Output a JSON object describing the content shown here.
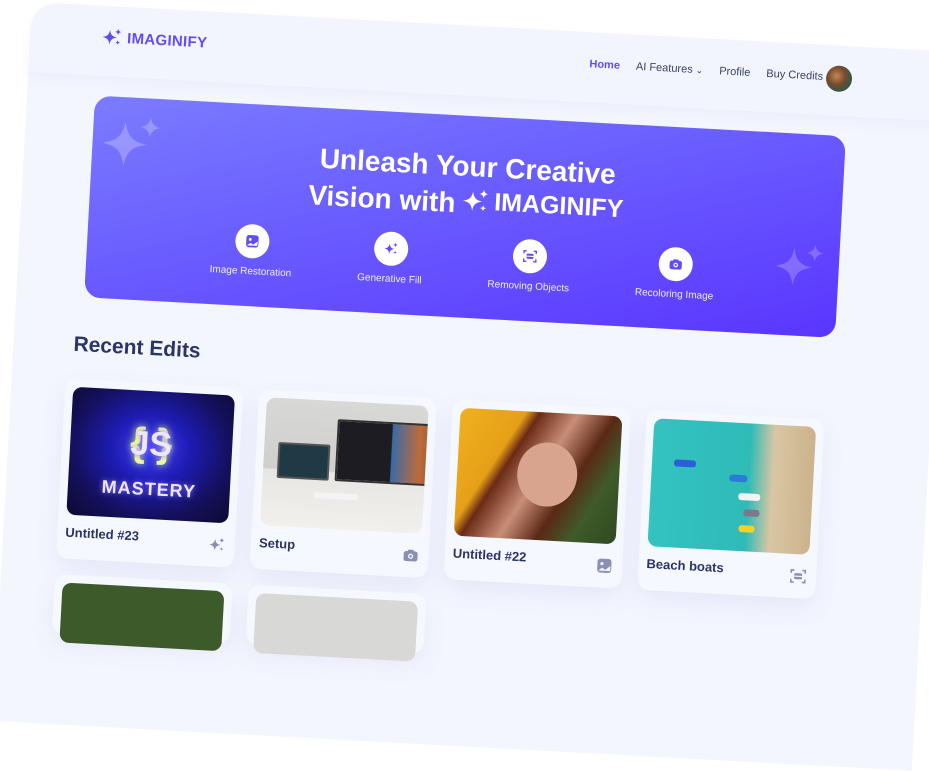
{
  "header": {
    "logo_text": "IMAGINIFY",
    "nav": [
      {
        "label": "Home",
        "active": true
      },
      {
        "label": "AI Features",
        "has_dropdown": true
      },
      {
        "label": "Profile"
      },
      {
        "label": "Buy Credits"
      }
    ]
  },
  "hero": {
    "title_line1": "Unleash Your Creative",
    "title_line2": "Vision with",
    "brand": "IMAGINIFY",
    "features": [
      {
        "label": "Image Restoration",
        "icon": "image-icon"
      },
      {
        "label": "Generative Fill",
        "icon": "stars-icon"
      },
      {
        "label": "Removing Objects",
        "icon": "scan-icon"
      },
      {
        "label": "Recoloring Image",
        "icon": "camera-icon"
      }
    ]
  },
  "recent": {
    "title": "Recent Edits",
    "items": [
      {
        "title": "Untitled #23",
        "icon": "stars-icon",
        "image_text": "{JS} MASTERY"
      },
      {
        "title": "Setup",
        "icon": "camera-icon"
      },
      {
        "title": "Untitled #22",
        "icon": "image-icon"
      },
      {
        "title": "Beach boats",
        "icon": "scan-icon"
      }
    ]
  },
  "colors": {
    "accent": "#624cf5",
    "heading": "#2b3467",
    "hero_start": "#7b7cff",
    "hero_end": "#5a35ff"
  }
}
